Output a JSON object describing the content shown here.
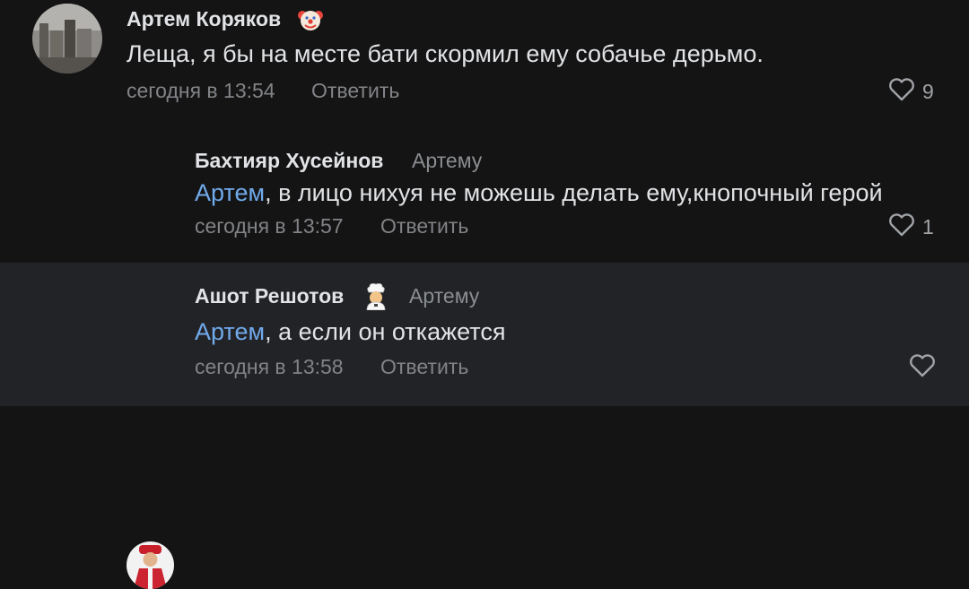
{
  "comments": [
    {
      "author": "Артем Коряков",
      "badge_icon": "clown-face-icon",
      "reply_to": "",
      "mention": "",
      "text": "Леща, я бы на месте бати скормил ему собачье дерьмо.",
      "time": "сегодня в 13:54",
      "reply_label": "Ответить",
      "likes": "9"
    },
    {
      "author": "Бахтияр Хусейнов",
      "reply_to": "Артему",
      "mention": "Артем",
      "text": ", в лицо нихуя не можешь делать ему,кнопочный герой",
      "time": "сегодня в 13:57",
      "reply_label": "Ответить",
      "likes": "1"
    },
    {
      "author": "Ашот Решотов",
      "badge_icon": "cook-icon",
      "reply_to": "Артему",
      "mention": "Артем",
      "text": ", а если он откажется",
      "time": "сегодня в 13:58",
      "reply_label": "Ответить",
      "likes": ""
    }
  ],
  "colors": {
    "background": "#141414",
    "highlight_row": "#222326",
    "mention": "#71aaeb",
    "secondary_text": "#828387"
  }
}
